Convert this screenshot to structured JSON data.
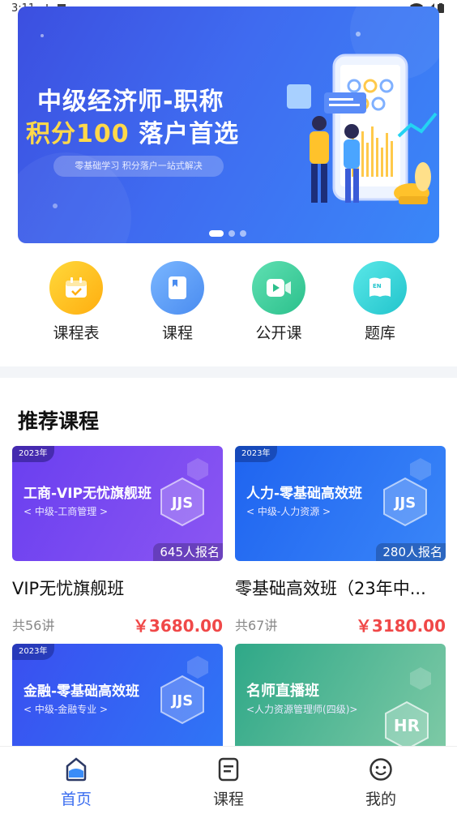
{
  "status_bar": {
    "time": "3:11"
  },
  "banner": {
    "title_line1": "中级经济师-职称",
    "title_line2_highlight": "积分100",
    "title_line2_rest": "落户首选",
    "subtitle": "零基础学习 积分落户一站式解决",
    "page_count": 3,
    "active_page": 1
  },
  "quick_links": [
    {
      "label": "课程表",
      "icon": "calendar-icon",
      "color": "#ffc21a"
    },
    {
      "label": "课程",
      "icon": "book-icon",
      "color": "#5aa0f5"
    },
    {
      "label": "公开课",
      "icon": "video-icon",
      "color": "#3ccf9c"
    },
    {
      "label": "题库",
      "icon": "question-bank-icon",
      "color": "#3ed6d6"
    }
  ],
  "section": {
    "title": "推荐课程"
  },
  "courses": [
    {
      "year": "2023年",
      "thumb_title": "工商-VIP无忧旗舰班",
      "thumb_subtitle": "< 中级-工商管理 >",
      "logo": "JJS",
      "enrolled": "645人报名",
      "name": "VIP无忧旗舰班",
      "lessons": "共56讲",
      "price": "￥3680.00"
    },
    {
      "year": "2023年",
      "thumb_title": "人力-零基础高效班",
      "thumb_subtitle": "< 中级-人力资源 >",
      "logo": "JJS",
      "enrolled": "280人报名",
      "name": "零基础高效班（23年中...",
      "lessons": "共67讲",
      "price": "￥3180.00"
    },
    {
      "year": "2023年",
      "thumb_title": "金融-零基础高效班",
      "thumb_subtitle": "< 中级-金融专业 >",
      "logo": "JJS"
    },
    {
      "thumb_title": "名师直播班",
      "thumb_subtitle": "<人力资源管理师(四级)>",
      "logo": "HR"
    }
  ],
  "bottom_nav": [
    {
      "label": "首页",
      "icon": "home-icon",
      "active": true
    },
    {
      "label": "课程",
      "icon": "course-icon",
      "active": false
    },
    {
      "label": "我的",
      "icon": "profile-icon",
      "active": false
    }
  ],
  "colors": {
    "accent": "#3a6df0",
    "price": "#f04848",
    "banner_highlight": "#ffd84a"
  }
}
